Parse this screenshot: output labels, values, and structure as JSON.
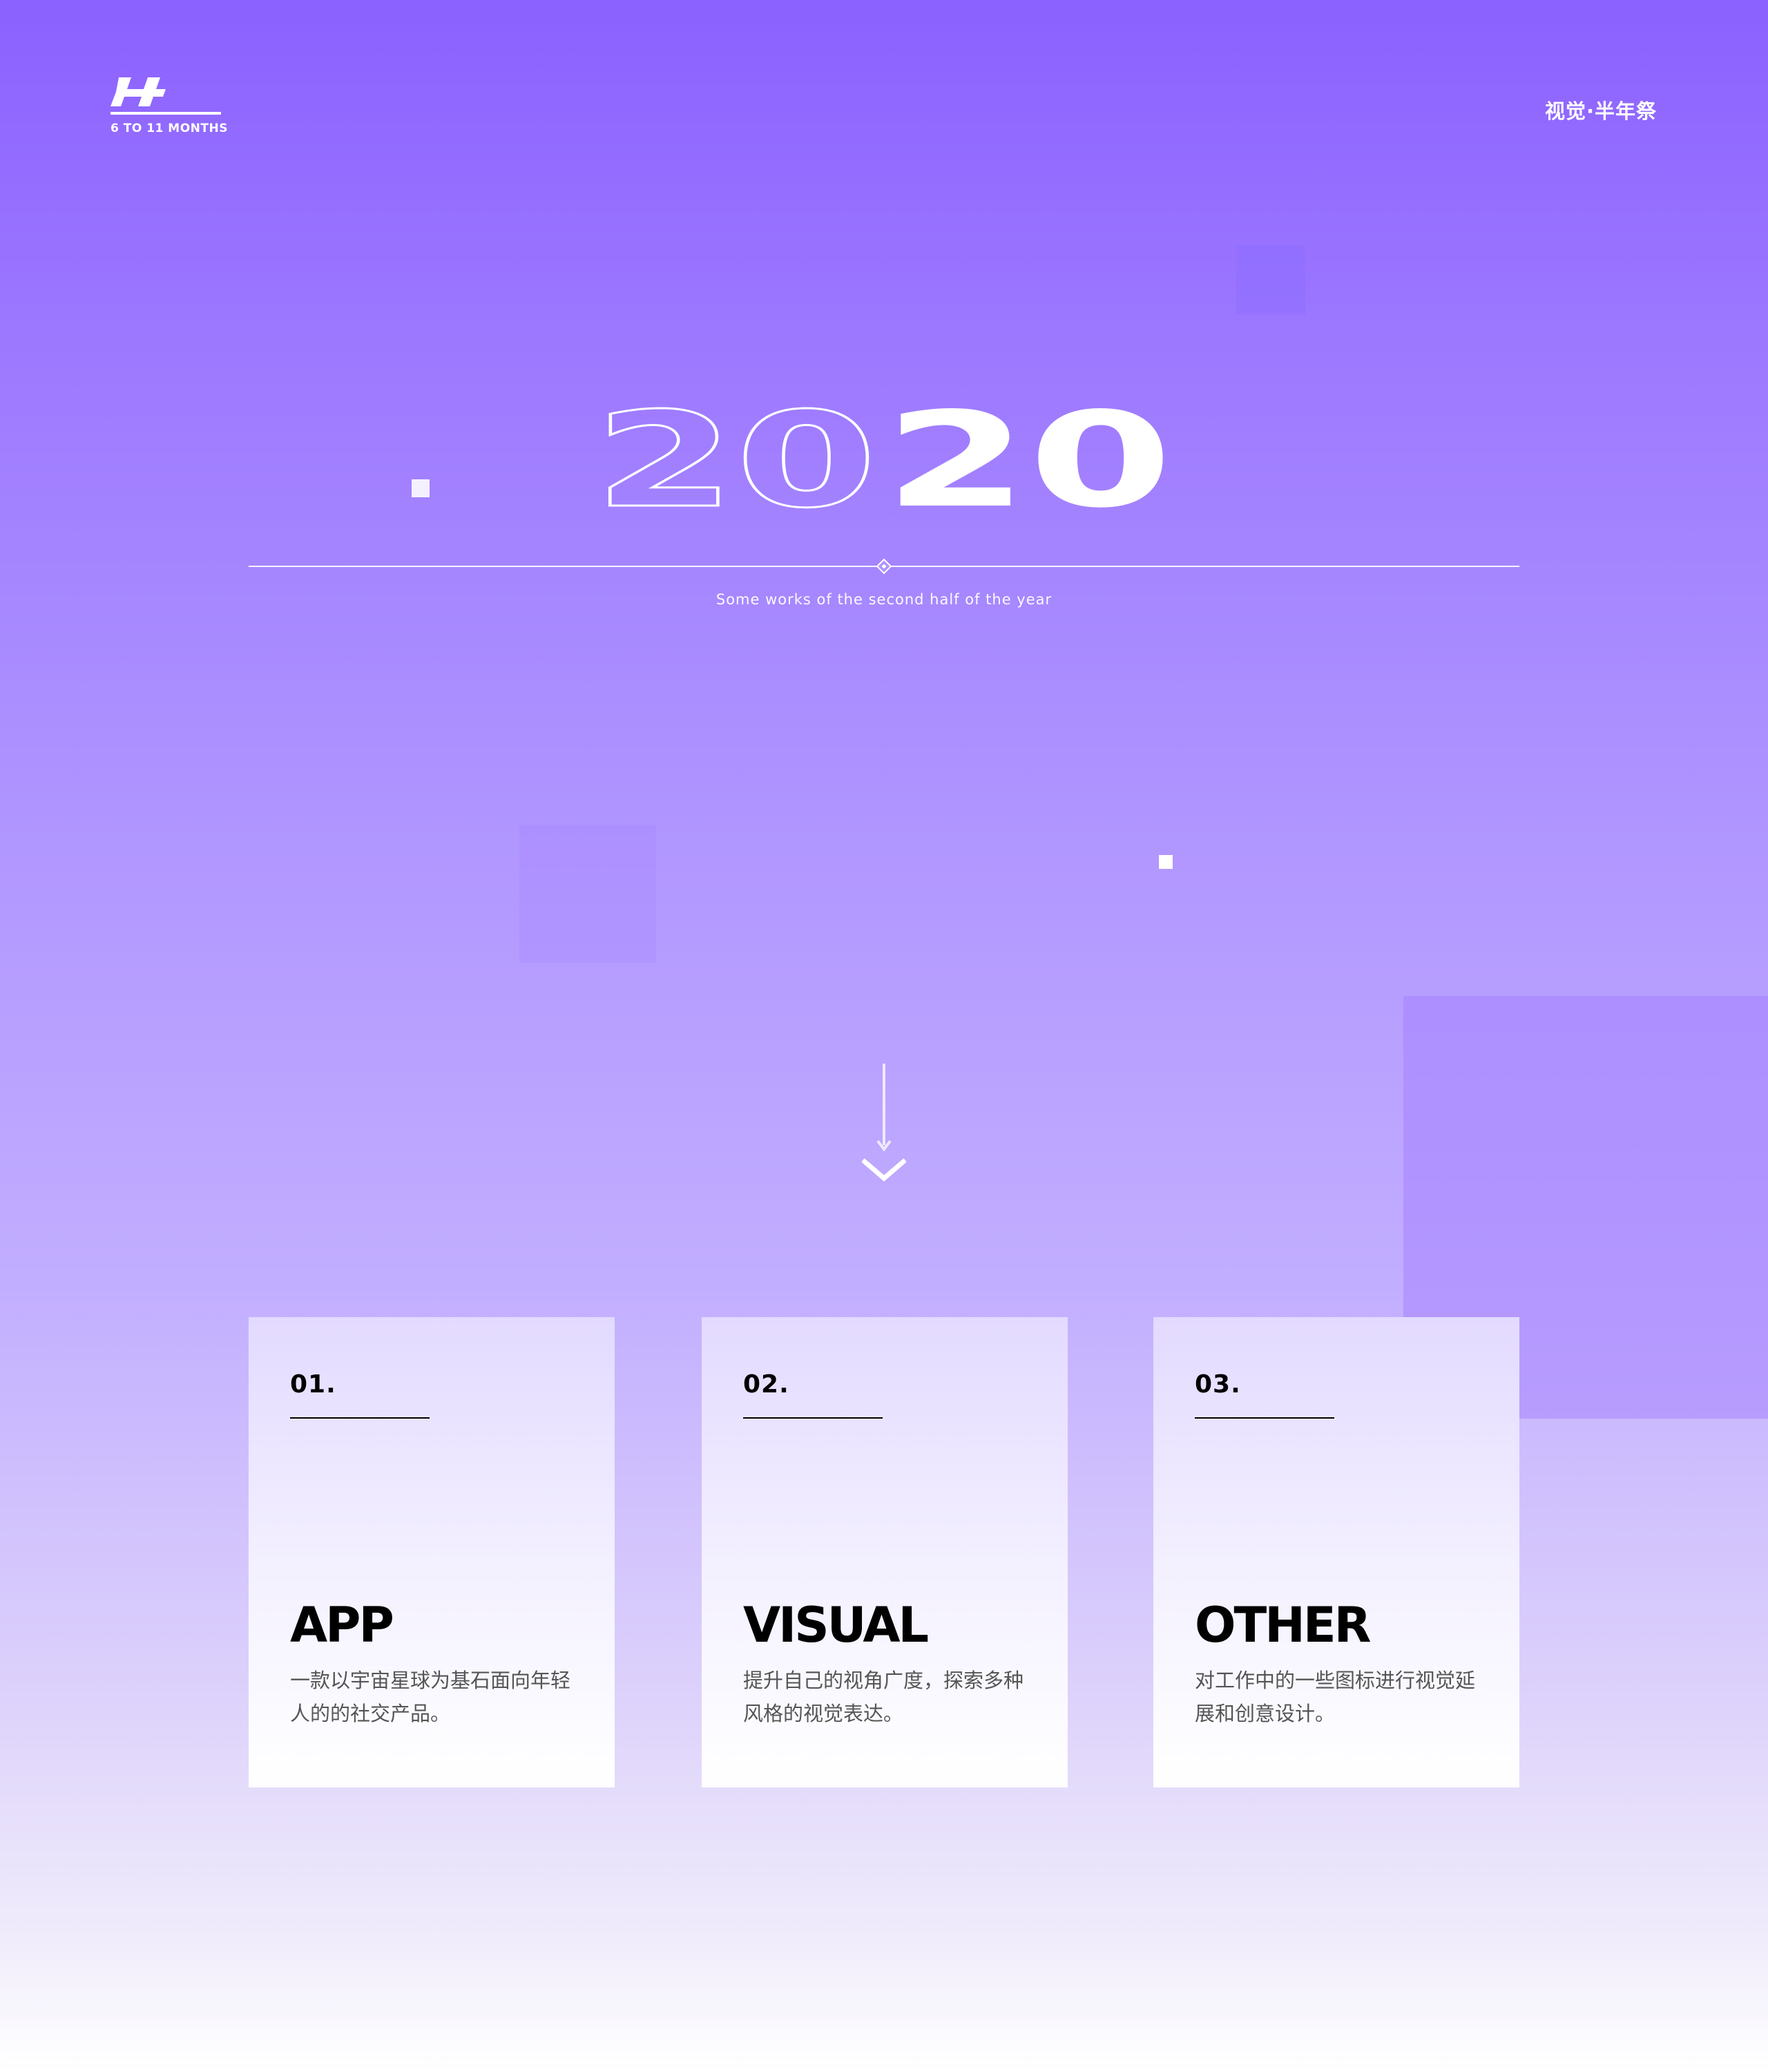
{
  "header": {
    "logo_text": "6 TO 11 MONTHS",
    "top_right_title": "视觉·半年祭"
  },
  "hero": {
    "year_outline": "20",
    "year_filled": "20",
    "subtitle": "Some works of the second half of the year"
  },
  "cards": [
    {
      "number": "01.",
      "title": "APP",
      "description": "一款以宇宙星球为基石面向年轻人的的社交产品。"
    },
    {
      "number": "02.",
      "title": "VISUAL",
      "description": "提升自己的视角广度，探索多种风格的视觉表达。"
    },
    {
      "number": "03.",
      "title": "OTHER",
      "description": "对工作中的一些图标进行视觉延展和创意设计。"
    }
  ],
  "icons": {
    "logo": "brand-logo-icon",
    "divider_ornament": "diamond-icon",
    "scroll": "arrow-down-icon"
  },
  "colors": {
    "background_top": "#8b61ff",
    "background_bottom": "#ffffff",
    "card_top": "#e3daff",
    "card_bottom": "#ffffff",
    "text_dark": "#000000",
    "text_muted": "#555555"
  }
}
